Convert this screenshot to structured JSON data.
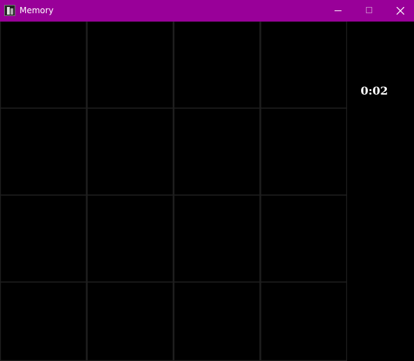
{
  "window": {
    "title": "Memory",
    "titlebar_color": "#990099",
    "controls": [
      "minimize-icon",
      "maximize-icon",
      "close-icon"
    ]
  },
  "board": {
    "rows": 4,
    "columns": 4,
    "card_color": "#000000",
    "grid_line_color": "#1f1f1f"
  },
  "timer": {
    "value": "0:02"
  }
}
